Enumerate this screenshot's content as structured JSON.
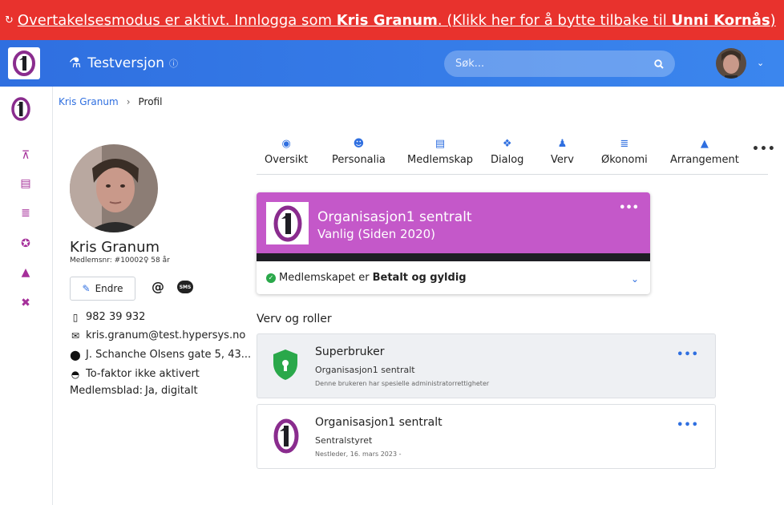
{
  "impersonation": {
    "pre": "Overtakelsesmodus er aktivt. Innlogga som ",
    "user": "Kris Granum",
    "mid": ". (Klikk her for å bytte tilbake til ",
    "original_user": "Unni Kornås",
    "post": ")"
  },
  "topbar": {
    "env_label": "Testversjon",
    "search_placeholder": "Søk..."
  },
  "breadcrumb": {
    "parent": "Kris Granum",
    "current": "Profil"
  },
  "profile": {
    "name": "Kris Granum",
    "meta": "Medlemsnr: #10002♀ 58 år",
    "edit_label": "Endre",
    "sms_label": "SMS",
    "phone": "982 39 932",
    "email": "kris.granum@test.hypersys.no",
    "address": "J. Schanche Olsens gate 5, 43...",
    "twofa": "To-faktor ikke aktivert",
    "newsletter_label": "Medlemsblad:",
    "newsletter_value": "Ja, digitalt"
  },
  "tabs": [
    {
      "label": "Oversikt",
      "icon": "eye-icon",
      "glyph": "◉"
    },
    {
      "label": "Personalia",
      "icon": "user-circle-icon",
      "glyph": "☻"
    },
    {
      "label": "Medlemskap",
      "icon": "id-card-icon",
      "glyph": "▤"
    },
    {
      "label": "Dialog",
      "icon": "comments-icon",
      "glyph": "❖"
    },
    {
      "label": "Verv",
      "icon": "user-icon",
      "glyph": "♟"
    },
    {
      "label": "Økonomi",
      "icon": "coins-icon",
      "glyph": "≣"
    },
    {
      "label": "Arrangement",
      "icon": "flask-icon",
      "glyph": "▲"
    }
  ],
  "membership": {
    "org": "Organisasjon1 sentralt",
    "type": "Vanlig (Siden 2020)",
    "status_pre": "Medlemskapet er",
    "status_value": "Betalt og gyldig"
  },
  "roles_title": "Verv og roller",
  "roles": [
    {
      "title": "Superbruker",
      "org": "Organisasjon1 sentralt",
      "desc": "Denne brukeren har spesielle administratorrettigheter"
    },
    {
      "title": "Organisasjon1 sentralt",
      "org": "Sentralstyret",
      "desc": "Nestleder, 16. mars 2023 -"
    }
  ],
  "colors": {
    "accent": "#2f6fe0",
    "banner": "#e8322d",
    "membership": "#c458c9",
    "nav_icon": "#a52f9a",
    "shield": "#2aa84a"
  }
}
